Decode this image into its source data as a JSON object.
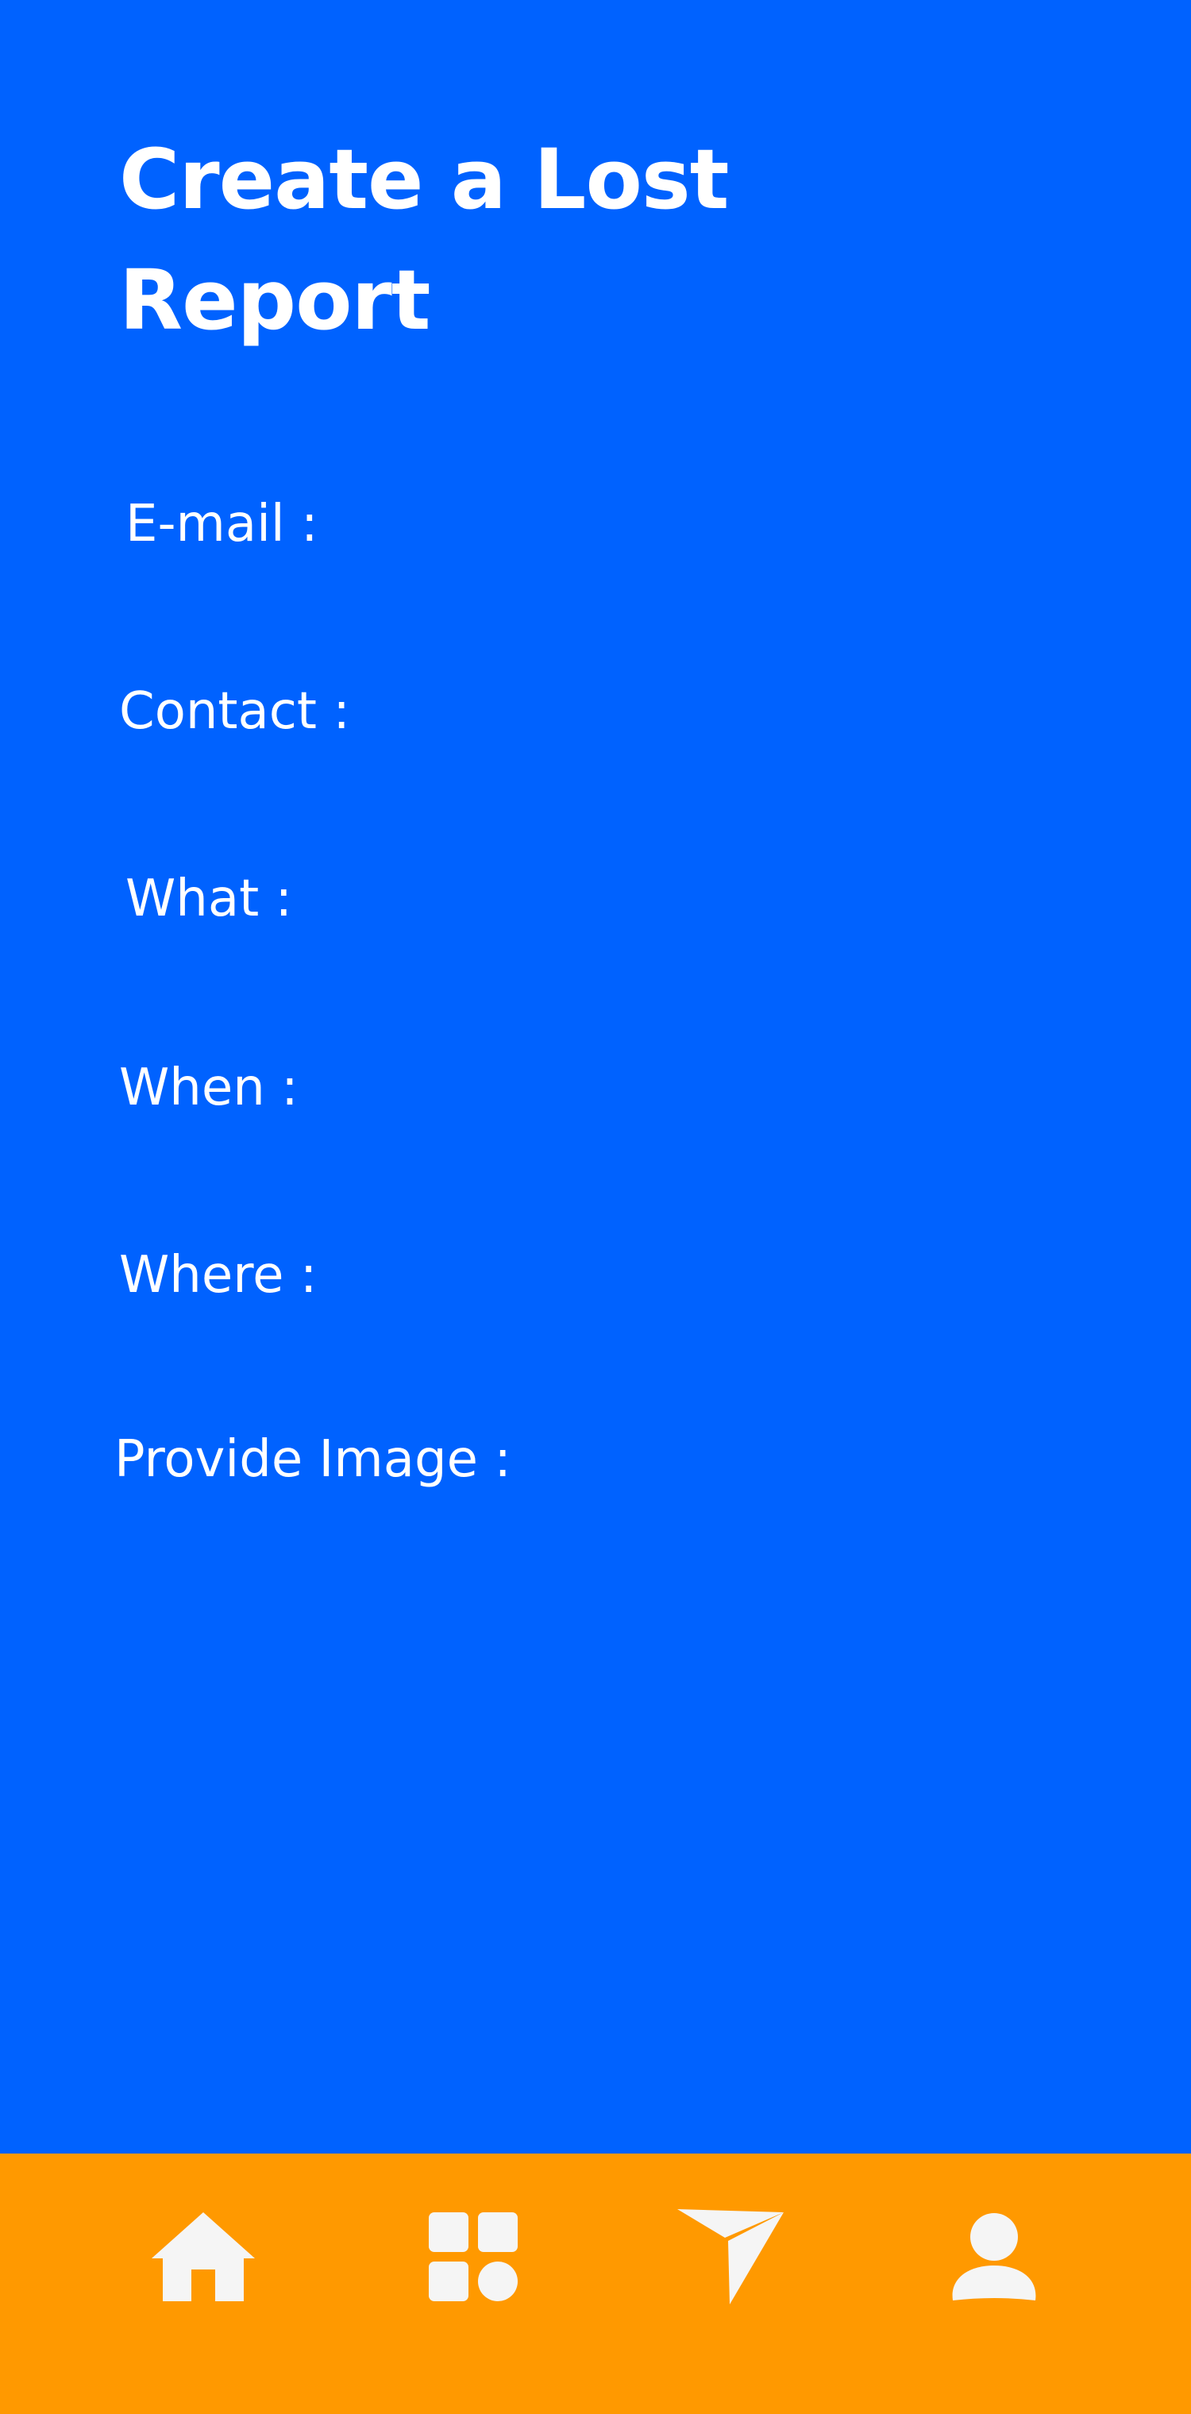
{
  "header": {
    "title": "Create a Lost Report"
  },
  "form": {
    "email_label": "E-mail :",
    "contact_label": "Contact :",
    "what_label": "What :",
    "when_label": "When :",
    "where_label": "Where :",
    "image_label": "Provide Image :"
  },
  "bottom_nav": {
    "items": [
      {
        "icon": "home-icon"
      },
      {
        "icon": "apps-grid-icon"
      },
      {
        "icon": "send-icon"
      },
      {
        "icon": "profile-icon"
      }
    ]
  },
  "colors": {
    "background": "#0062ff",
    "nav_bar": "#ff9900",
    "text": "#ffffff",
    "icon": "#f5f5f5"
  }
}
